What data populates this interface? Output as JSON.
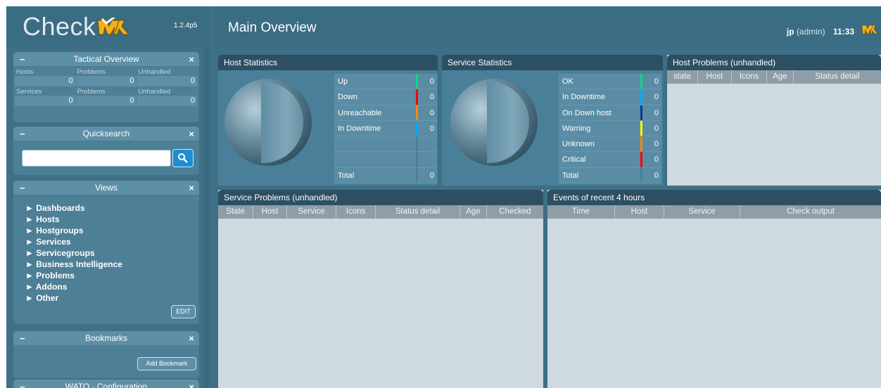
{
  "app": {
    "logo_text": "Check",
    "logo_mark": "MK",
    "version": "1.2.4p5"
  },
  "header": {
    "title": "Main Overview",
    "user": "jp",
    "role": "(admin)",
    "time": "11:33"
  },
  "sidebar": {
    "tactical": {
      "title": "Tactical Overview",
      "rows": [
        {
          "labels": [
            "Hosts",
            "Problems",
            "Unhandled"
          ],
          "values": [
            "0",
            "0",
            "0"
          ]
        },
        {
          "labels": [
            "Services",
            "Problems",
            "Unhandled"
          ],
          "values": [
            "0",
            "0",
            "0"
          ]
        }
      ]
    },
    "quicksearch": {
      "title": "Quicksearch",
      "placeholder": ""
    },
    "views": {
      "title": "Views",
      "items": [
        "► Dashboards",
        "► Hosts",
        "► Hostgroups",
        "► Services",
        "► Servicegroups",
        "► Business Intelligence",
        "► Problems",
        "► Addons",
        "► Other"
      ],
      "edit_label": "EDIT"
    },
    "bookmarks": {
      "title": "Bookmarks",
      "add_label": "Add Bookmark"
    },
    "wato": {
      "title": "WATO · Configuration"
    }
  },
  "host_stats": {
    "title": "Host Statistics",
    "rows": [
      {
        "label": "Up",
        "value": "0",
        "color": "#13d389"
      },
      {
        "label": "Down",
        "value": "0",
        "color": "#ff0000"
      },
      {
        "label": "Unreachable",
        "value": "0",
        "color": "#ff8800"
      },
      {
        "label": "In Downtime",
        "value": "0",
        "color": "#00aaff"
      },
      {
        "label": "",
        "value": "",
        "color": ""
      },
      {
        "label": "",
        "value": "",
        "color": ""
      },
      {
        "label": "Total",
        "value": "0",
        "color": ""
      }
    ]
  },
  "service_stats": {
    "title": "Service Statistics",
    "rows": [
      {
        "label": "OK",
        "value": "0",
        "color": "#13d389"
      },
      {
        "label": "In Downtime",
        "value": "0",
        "color": "#00aaff"
      },
      {
        "label": "On Down host",
        "value": "0",
        "color": "#0b3a8b"
      },
      {
        "label": "Warning",
        "value": "0",
        "color": "#ffff00"
      },
      {
        "label": "Unknown",
        "value": "0",
        "color": "#ff8800"
      },
      {
        "label": "Critical",
        "value": "0",
        "color": "#ff0000"
      },
      {
        "label": "Total",
        "value": "0",
        "color": ""
      }
    ]
  },
  "host_problems": {
    "title": "Host Problems (unhandled)",
    "columns": [
      "state",
      "Host",
      "Icons",
      "Age",
      "Status detail"
    ]
  },
  "service_problems": {
    "title": "Service Problems (unhandled)",
    "columns": [
      "State",
      "Host",
      "Service",
      "Icons",
      "Status detail",
      "Age",
      "Checked"
    ]
  },
  "events": {
    "title": "Events of recent 4 hours",
    "columns": [
      "Time",
      "Host",
      "Service",
      "Check output"
    ]
  }
}
